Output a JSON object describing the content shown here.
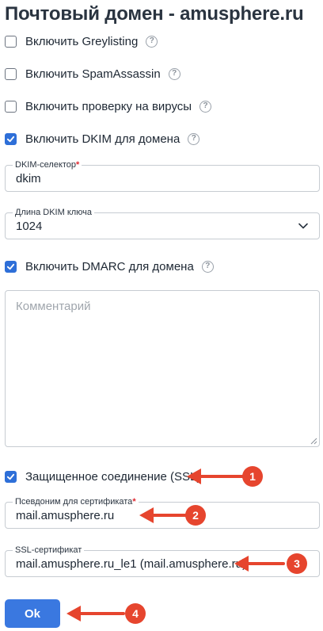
{
  "page": {
    "title": "Почтовый домен - amusphere.ru"
  },
  "checkboxes": {
    "greylisting": {
      "label": "Включить Greylisting",
      "checked": false
    },
    "spamassassin": {
      "label": "Включить SpamAssassin",
      "checked": false
    },
    "antivirus": {
      "label": "Включить проверку на вирусы",
      "checked": false
    },
    "dkim": {
      "label": "Включить DKIM для домена",
      "checked": true
    },
    "dmarc": {
      "label": "Включить DMARC для домена",
      "checked": true
    },
    "ssl": {
      "label": "Защищенное соединение (SSL)",
      "checked": true
    }
  },
  "help_glyph": "?",
  "fields": {
    "dkim_selector": {
      "label": "DKIM-селектор",
      "required_mark": "*",
      "value": "dkim"
    },
    "dkim_key_length": {
      "label": "Длина DKIM ключа",
      "value": "1024"
    },
    "comment": {
      "placeholder": "Комментарий",
      "value": ""
    },
    "cert_alias": {
      "label": "Псевдоним для сертификата",
      "required_mark": "*",
      "value": "mail.amusphere.ru"
    },
    "ssl_cert": {
      "label": "SSL-сертификат",
      "value": "mail.amusphere.ru_le1 (mail.amusphere.ru)"
    }
  },
  "buttons": {
    "ok": "Ok"
  },
  "annotations": [
    "1",
    "2",
    "3",
    "4"
  ],
  "colors": {
    "accent": "#2e6fd8",
    "button": "#3a78e0",
    "annotation": "#e6452e",
    "required": "#e0272f"
  }
}
